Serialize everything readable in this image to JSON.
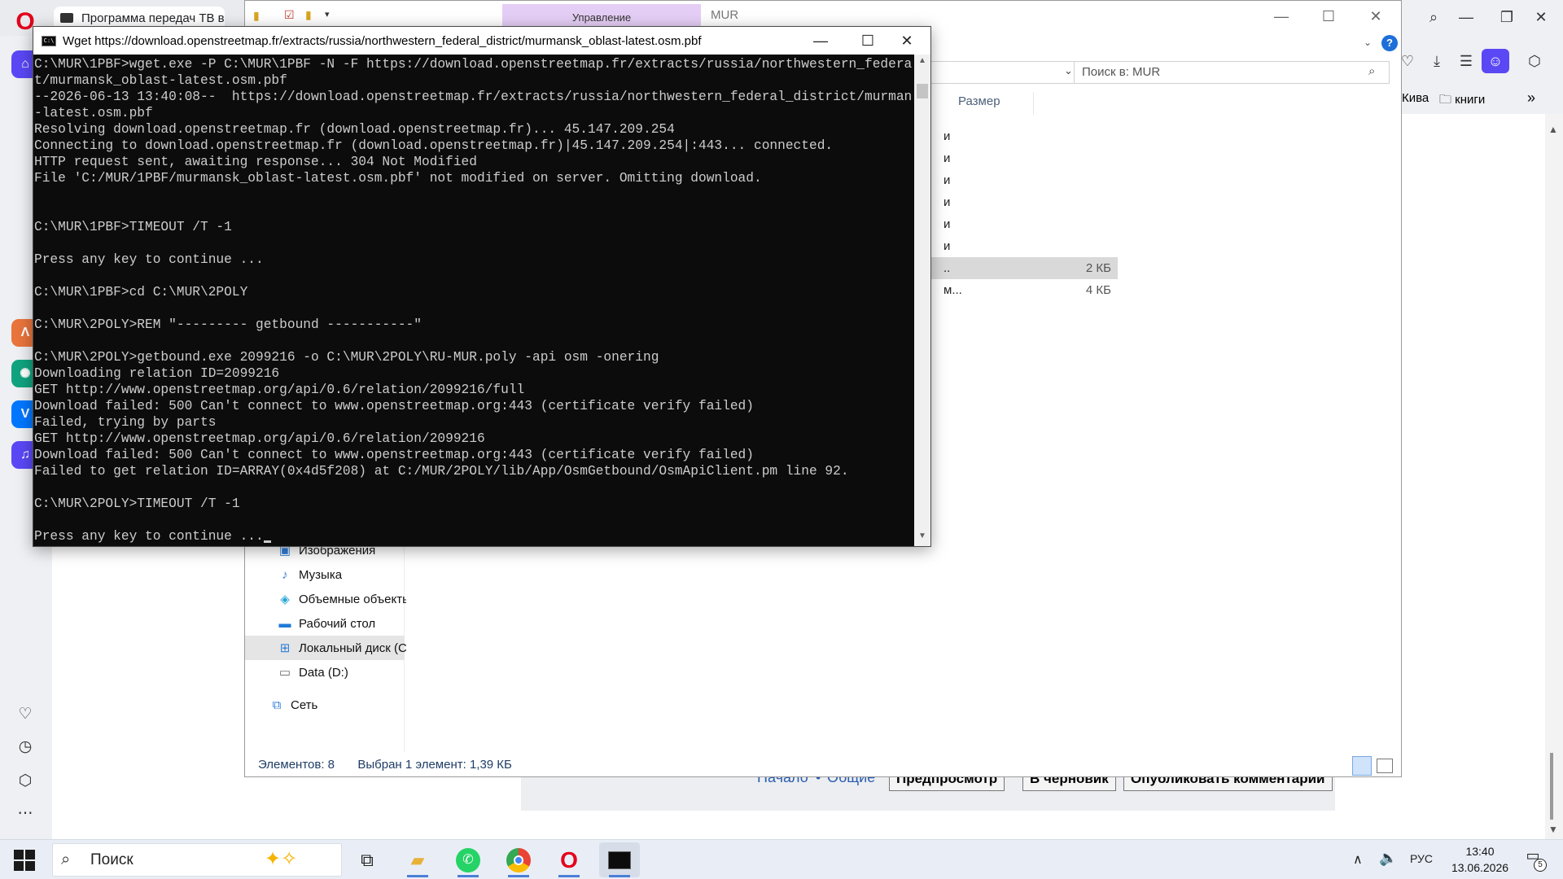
{
  "browser": {
    "tabs": [
      {
        "title": "Программа передач ТВ в"
      }
    ],
    "bookmarks": [
      "Кива",
      "книги"
    ],
    "sidebar_icons": [
      "home-icon",
      "aria-icon",
      "chatgpt-icon",
      "vk-icon",
      "player-icon",
      "heart-icon",
      "history-icon",
      "box-icon",
      "more-icon"
    ],
    "webpage": {
      "links": [
        "Начало",
        "Общие"
      ],
      "separator": "•",
      "buttons": [
        "Предпросмотр",
        "В черновик",
        "Опубликовать комментарии"
      ]
    }
  },
  "explorer": {
    "title": "MUR",
    "ribbon_context_tab": "Управление",
    "search_placeholder": "Поиск в: MUR",
    "column_size": "Размер",
    "partial_rows": [
      "и",
      "и",
      "и",
      "и",
      "и",
      "и"
    ],
    "files": [
      {
        "name_fragment": "..",
        "size": "2 КБ",
        "selected": true
      },
      {
        "name_fragment": "м...",
        "size": "4 КБ",
        "selected": false
      }
    ],
    "nav": [
      {
        "label": "Изображения",
        "icon": "pictures-icon"
      },
      {
        "label": "Музыка",
        "icon": "music-icon"
      },
      {
        "label": "Объемные объекты",
        "icon": "3d-objects-icon"
      },
      {
        "label": "Рабочий стол",
        "icon": "desktop-icon"
      },
      {
        "label": "Локальный диск (C:)",
        "icon": "local-disk-icon"
      },
      {
        "label": "Data (D:)",
        "icon": "drive-icon"
      },
      {
        "label": "Сеть",
        "icon": "network-icon"
      }
    ],
    "status": {
      "count": "Элементов: 8",
      "selected": "Выбран 1 элемент: 1,39 КБ"
    }
  },
  "console": {
    "title": "Wget https://download.openstreetmap.fr/extracts/russia/northwestern_federal_district/murmansk_oblast-latest.osm.pbf",
    "lines": [
      "C:\\MUR\\1PBF>wget.exe -P C:\\MUR\\1PBF -N -F https://download.openstreetmap.fr/extracts/russia/northwestern_federal_distric",
      "t/murmansk_oblast-latest.osm.pbf",
      "--2026-06-13 13:40:08--  https://download.openstreetmap.fr/extracts/russia/northwestern_federal_district/murmansk_oblast",
      "-latest.osm.pbf",
      "Resolving download.openstreetmap.fr (download.openstreetmap.fr)... 45.147.209.254",
      "Connecting to download.openstreetmap.fr (download.openstreetmap.fr)|45.147.209.254|:443... connected.",
      "HTTP request sent, awaiting response... 304 Not Modified",
      "File 'C:/MUR/1PBF/murmansk_oblast-latest.osm.pbf' not modified on server. Omitting download.",
      "",
      "",
      "C:\\MUR\\1PBF>TIMEOUT /T -1",
      "",
      "Press any key to continue ...",
      "",
      "C:\\MUR\\1PBF>cd C:\\MUR\\2POLY",
      "",
      "C:\\MUR\\2POLY>REM \"--------- getbound -----------\"",
      "",
      "C:\\MUR\\2POLY>getbound.exe 2099216 -o C:\\MUR\\2POLY\\RU-MUR.poly -api osm -onering",
      "Downloading relation ID=2099216",
      "GET http://www.openstreetmap.org/api/0.6/relation/2099216/full",
      "Download failed: 500 Can't connect to www.openstreetmap.org:443 (certificate verify failed)",
      "Failed, trying by parts",
      "GET http://www.openstreetmap.org/api/0.6/relation/2099216",
      "Download failed: 500 Can't connect to www.openstreetmap.org:443 (certificate verify failed)",
      "Failed to get relation ID=ARRAY(0x4d5f208) at C:/MUR/2POLY/lib/App/OsmGetbound/OsmApiClient.pm line 92.",
      "",
      "C:\\MUR\\2POLY>TIMEOUT /T -1",
      "",
      "Press any key to continue ..."
    ]
  },
  "taskbar": {
    "search_placeholder": "Поиск",
    "apps": [
      "task-view-icon",
      "file-explorer-icon",
      "whatsapp-icon",
      "chrome-icon",
      "opera-icon",
      "console-icon"
    ],
    "lang": "РУС",
    "time": "13:40",
    "date": "13.06.2026",
    "notifications": "5"
  },
  "colors": {
    "console_bg": "#0c0c0c",
    "console_text": "#cccccc",
    "opera_red": "#e4001b",
    "manage_tab": "#e5cef5",
    "taskbar_bg": "#e9eef6"
  }
}
